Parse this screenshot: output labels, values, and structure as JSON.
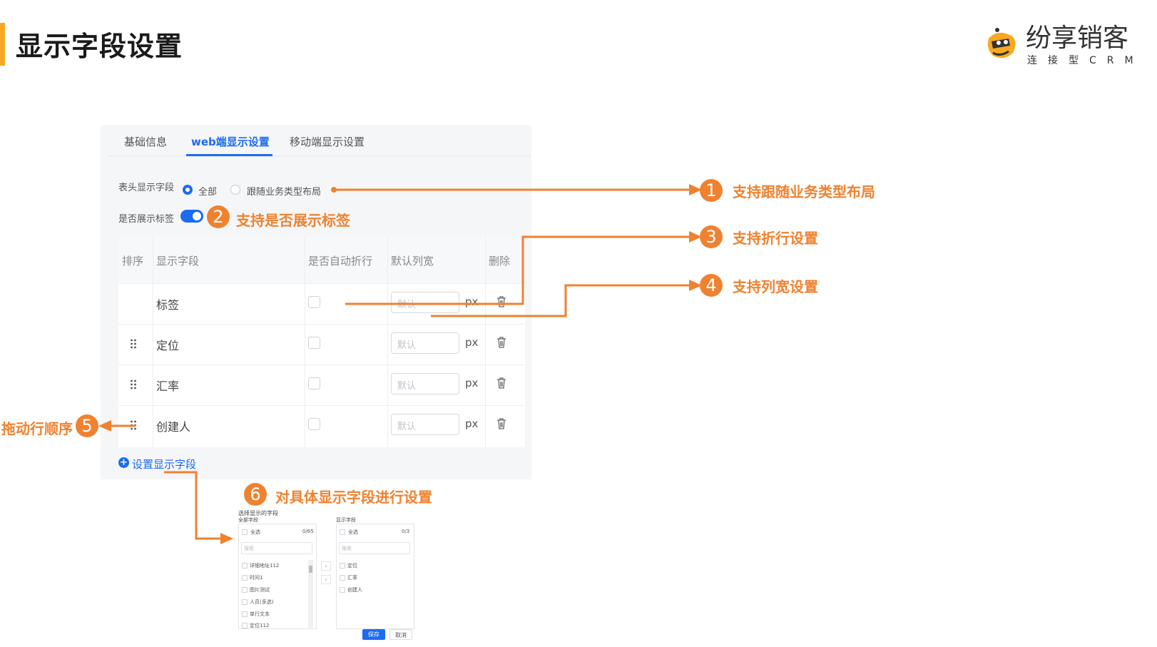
{
  "header": {
    "title": "显示字段设置",
    "logo_main": "纷享销客",
    "logo_sub": "连接型CRM"
  },
  "tabs": [
    {
      "label": "基础信息",
      "active": false
    },
    {
      "label": "web端显示设置",
      "active": true
    },
    {
      "label": "移动端显示设置",
      "active": false
    }
  ],
  "settings": {
    "header_field_label": "表头显示字段",
    "radio_all": "全部",
    "radio_follow": "跟随业务类型布局",
    "show_tag_label": "是否展示标签",
    "show_tag_on": true
  },
  "table": {
    "headers": [
      "排序",
      "显示字段",
      "是否自动折行",
      "默认列宽",
      "删除"
    ],
    "rows": [
      {
        "field": "标签",
        "placeholder": "默认",
        "unit": "px"
      },
      {
        "field": "定位",
        "placeholder": "默认",
        "unit": "px"
      },
      {
        "field": "汇率",
        "placeholder": "默认",
        "unit": "px"
      },
      {
        "field": "创建人",
        "placeholder": "默认",
        "unit": "px"
      }
    ],
    "add_label": "设置显示字段"
  },
  "annotations": [
    {
      "num": "1",
      "text": "支持跟随业务类型布局"
    },
    {
      "num": "2",
      "text": "支持是否展示标签"
    },
    {
      "num": "3",
      "text": "支持折行设置"
    },
    {
      "num": "4",
      "text": "支持列宽设置"
    },
    {
      "num": "5",
      "text": "拖动行顺序"
    },
    {
      "num": "6",
      "text": "对具体显示字段进行设置"
    }
  ],
  "dialog": {
    "title": "选择显示的字段",
    "left": {
      "caption": "全部字段",
      "select_all": "全选",
      "count": "0/65",
      "search_placeholder": "搜索",
      "items": [
        "详细地址112",
        "时间1",
        "图片测试",
        "人员(多选)",
        "单行文本",
        "定位112"
      ]
    },
    "right": {
      "caption": "显示字段",
      "select_all": "全选",
      "count": "0/3",
      "search_placeholder": "搜索",
      "items": [
        "定位",
        "汇率",
        "创建人"
      ]
    },
    "save_label": "保存",
    "cancel_label": "取消"
  },
  "colors": {
    "accent": "#1d6bf0",
    "annotation": "#ef8230",
    "title_bar": "#f7a823"
  }
}
